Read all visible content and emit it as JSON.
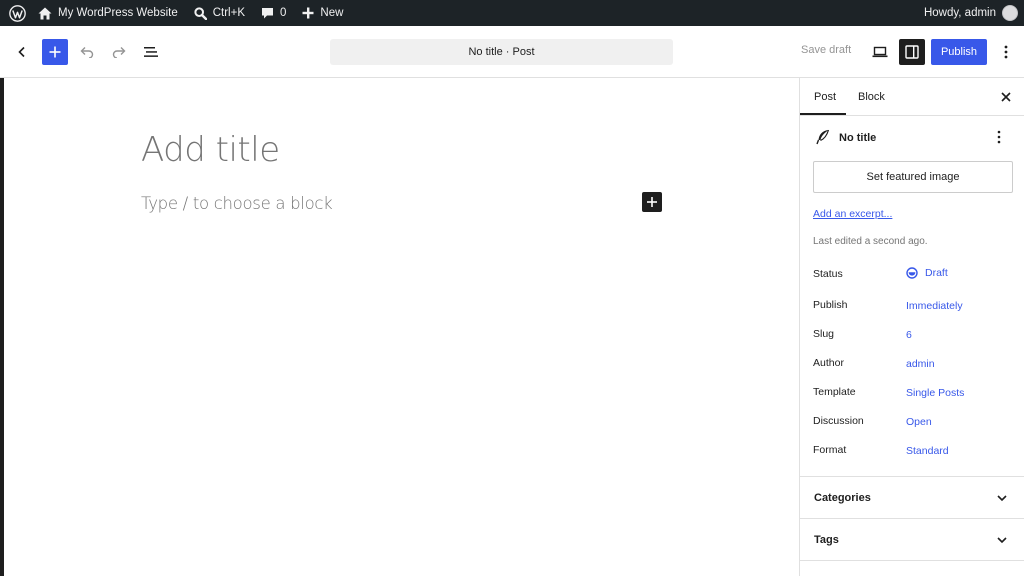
{
  "admin_bar": {
    "site_name": "My WordPress Website",
    "search_shortcut": "Ctrl+K",
    "comments_count": "0",
    "new_label": "New",
    "howdy": "Howdy, admin"
  },
  "header": {
    "document_title": "No title · Post",
    "save_draft_label": "Save draft",
    "publish_label": "Publish"
  },
  "canvas": {
    "title_placeholder": "Add title",
    "block_placeholder": "Type / to choose a block"
  },
  "sidebar": {
    "tabs": [
      {
        "label": "Post"
      },
      {
        "label": "Block"
      }
    ],
    "post_title": "No title",
    "featured_image_label": "Set featured image",
    "excerpt_link": "Add an excerpt...",
    "last_edited": "Last edited a second ago.",
    "meta": [
      {
        "label": "Status",
        "value": "Draft"
      },
      {
        "label": "Publish",
        "value": "Immediately"
      },
      {
        "label": "Slug",
        "value": "6"
      },
      {
        "label": "Author",
        "value": "admin"
      },
      {
        "label": "Template",
        "value": "Single Posts"
      },
      {
        "label": "Discussion",
        "value": "Open"
      },
      {
        "label": "Format",
        "value": "Standard"
      }
    ],
    "panels": [
      {
        "title": "Categories"
      },
      {
        "title": "Tags"
      }
    ]
  },
  "colors": {
    "accent": "#3858e9",
    "admin_bar_bg": "#1d2327",
    "text": "#1e1e1e",
    "placeholder": "#757575"
  }
}
